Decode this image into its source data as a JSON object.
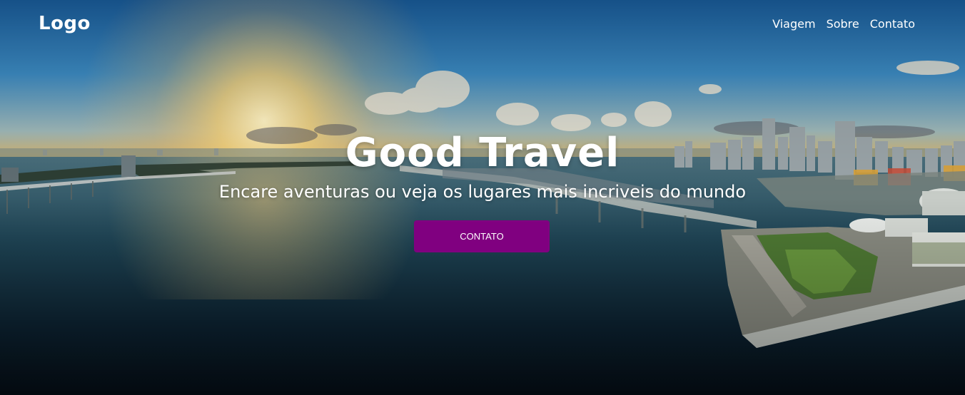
{
  "header": {
    "logo": "Logo",
    "nav": [
      {
        "label": "Viagem"
      },
      {
        "label": "Sobre"
      },
      {
        "label": "Contato"
      }
    ]
  },
  "hero": {
    "title": "Good Travel",
    "subtitle": "Encare aventuras ou veja os lugares mais incriveis do mundo",
    "button_label": "CONTATO",
    "background_image": "aerial city skyline at sunset with bay and bridges"
  },
  "colors": {
    "accent": "#800080",
    "text": "#ffffff"
  }
}
